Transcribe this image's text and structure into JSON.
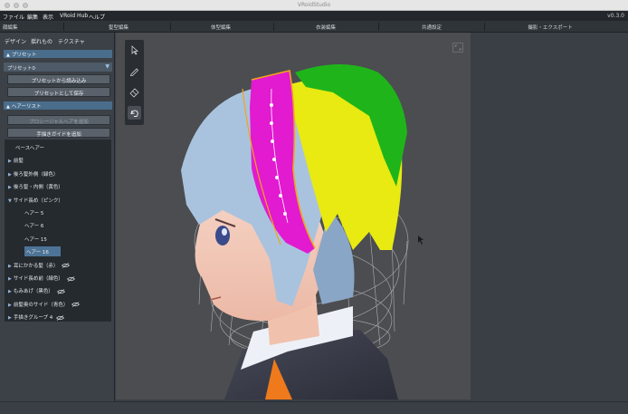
{
  "window": {
    "title": "VRoidStudio",
    "version": "v0.3.0"
  },
  "menu": [
    "ファイル",
    "編集",
    "表示",
    "VRoid Hub",
    "ヘルプ"
  ],
  "main_tabs": [
    "顔編集",
    "髪型編集",
    "体型編集",
    "衣装編集",
    "共通設定",
    "撮影・エクスポート"
  ],
  "sub_tabs": [
    "デザイン",
    "揺れもの",
    "テクスチャ"
  ],
  "preset_section": {
    "title": "プリセット",
    "selected": "プリセット0",
    "load_button": "プリセットから読み込み",
    "save_button": "プリセットとして保存"
  },
  "hair_section": {
    "title": "ヘアーリスト",
    "add_procedural": "プロシージャルヘアを追加",
    "add_guide": "手描きガイドを追加",
    "items": [
      {
        "label": "ベースヘアー",
        "depth": 0,
        "arrow": "",
        "hidden": false,
        "selected": false
      },
      {
        "label": "前髪",
        "depth": 0,
        "arrow": "right",
        "hidden": false,
        "selected": false
      },
      {
        "label": "後ろ髪外側（緑色）",
        "depth": 0,
        "arrow": "right",
        "hidden": false,
        "selected": false
      },
      {
        "label": "後ろ髪・内側（黄色）",
        "depth": 0,
        "arrow": "right",
        "hidden": false,
        "selected": false
      },
      {
        "label": "サイド長め（ピンク）",
        "depth": 0,
        "arrow": "down",
        "hidden": false,
        "selected": false
      },
      {
        "label": "ヘアー 5",
        "depth": 1,
        "arrow": "",
        "hidden": false,
        "selected": false
      },
      {
        "label": "ヘアー 6",
        "depth": 1,
        "arrow": "",
        "hidden": false,
        "selected": false
      },
      {
        "label": "ヘアー 15",
        "depth": 1,
        "arrow": "",
        "hidden": false,
        "selected": false
      },
      {
        "label": "ヘアー 16",
        "depth": 1,
        "arrow": "",
        "hidden": false,
        "selected": true
      },
      {
        "label": "耳にかかる髪（赤）",
        "depth": 0,
        "arrow": "right",
        "hidden": true,
        "selected": false
      },
      {
        "label": "サイド長め前（緑色）",
        "depth": 0,
        "arrow": "right",
        "hidden": true,
        "selected": false
      },
      {
        "label": "もみあげ（黒色）",
        "depth": 0,
        "arrow": "right",
        "hidden": true,
        "selected": false
      },
      {
        "label": "前髪奥のサイド（青色）",
        "depth": 0,
        "arrow": "right",
        "hidden": true,
        "selected": false
      },
      {
        "label": "手描きグループ 4",
        "depth": 0,
        "arrow": "right",
        "hidden": true,
        "selected": false
      }
    ]
  },
  "viewport_tools": [
    "select-tool",
    "pen-tool",
    "eraser-tool",
    "undo-tool"
  ],
  "colors": {
    "accent": "#4a6d8c",
    "hair_green": "#1fb51a",
    "hair_yellow": "#e8ea12",
    "hair_magenta": "#e21ad0",
    "hair_base": "#a9c3df"
  }
}
